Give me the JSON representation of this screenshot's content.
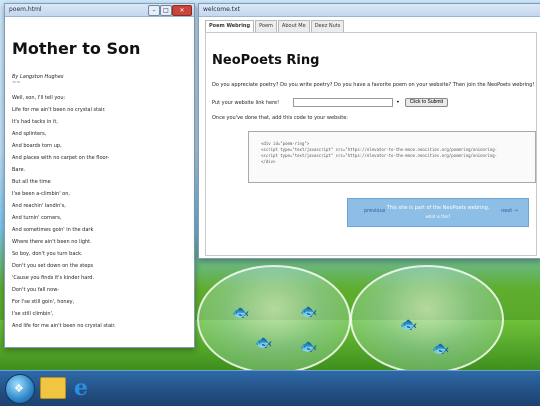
{
  "desktop": {
    "taskbar": {
      "start_icon": "windows-orb-icon",
      "folder_icon": "folder-icon",
      "ie_icon": "internet-explorer-icon"
    }
  },
  "poem_window": {
    "title": "poem.html",
    "controls": {
      "minimize": "–",
      "maximize": "□",
      "close": "✕"
    },
    "heading": "Mother to Son",
    "author": "By Langston Hughes",
    "separator": "~~",
    "lines": [
      "Well, son, I'll tell you:",
      "Life for me ain't been no crystal stair.",
      "It's had tacks in it,",
      "And splinters,",
      "And boards torn up,",
      "And places with no carpet on the floor-",
      "Bare.",
      "But all the time",
      "I'se been a-climbin' on,",
      "And reachin' landin's,",
      "And turnin' corners,",
      "And sometimes goin' in the dark",
      "Where there ain't been no light.",
      "So boy, don't you turn back.",
      "Don't you set down on the steps",
      "'Cause you finds it's kinder hard.",
      "Don't you fall now-",
      "For I'se still goin', honey,",
      "I'se still climbin',",
      "And life for me ain't been no crystal stair."
    ]
  },
  "webring_window": {
    "title": "welcome.txt",
    "controls": {
      "minimize": "–",
      "maximize": "□",
      "close": "✕"
    },
    "tabs": [
      "Poem Webring",
      "Poem",
      "About Me",
      "Deez Nuts"
    ],
    "heading": "NeoPoets Ring",
    "intro": "Do you appreciate poetry? Do you write poetry? Do you have a favorite poem on your website? Then join the NeoPoets webring!",
    "link_label": "Put your website link here!",
    "link_input_value": "",
    "submit_label": "Click to Submit",
    "code_intro": "Once you've done that, add this code to your website:",
    "code_lines": [
      "<div id=\"poem-ring\">",
      "<script type=\"text/javascript\" src=\"https://elevator-to-the-moon.neocities.org/poemring/onionring-",
      "<script type=\"text/javascript\" src=\"https://elevator-to-the-moon.neocities.org/poemring/onionring-",
      "</div>"
    ],
    "banner": {
      "prev": "previous",
      "text": "This site is part of the NeoPoets webring.",
      "link": "what is this?",
      "next": "next →"
    }
  }
}
